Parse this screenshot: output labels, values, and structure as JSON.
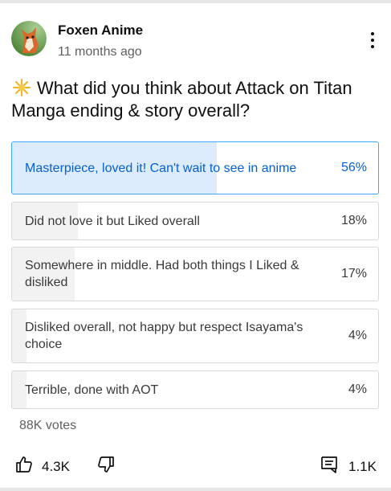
{
  "post": {
    "channel_name": "Foxen Anime",
    "timestamp": "11 months ago",
    "question": "What did you think about Attack on Titan Manga ending & story overall?",
    "question_icon": "sparkle-icon",
    "menu_icon": "more-vertical-icon"
  },
  "poll": {
    "options": [
      {
        "label": "Masterpiece, loved it! Can't wait to see in anime",
        "percent_label": "56%",
        "percent": 56,
        "selected": true
      },
      {
        "label": "Did not love it but Liked overall",
        "percent_label": "18%",
        "percent": 18,
        "selected": false
      },
      {
        "label": "Somewhere in middle. Had both things I Liked & disliked",
        "percent_label": "17%",
        "percent": 17,
        "selected": false
      },
      {
        "label": "Disliked overall, not happy but respect Isayama's choice",
        "percent_label": "4%",
        "percent": 4,
        "selected": false
      },
      {
        "label": "Terrible, done with AOT",
        "percent_label": "4%",
        "percent": 4,
        "selected": false
      }
    ],
    "votes": "88K votes"
  },
  "actions": {
    "likes": "4.3K",
    "comments": "1.1K",
    "like_icon": "thumbs-up-icon",
    "dislike_icon": "thumbs-down-icon",
    "comment_icon": "comment-icon"
  },
  "colors": {
    "selected_border": "#3ea6ff",
    "selected_fill": "#dcecfc",
    "selected_text": "#065fd4",
    "unselected_fill": "#f2f2f2"
  }
}
